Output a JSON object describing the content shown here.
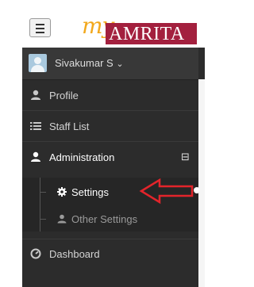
{
  "header": {
    "logo_prefix": "my",
    "logo_brand": "AMRITA"
  },
  "user": {
    "name": "Sivakumar S",
    "dropdown_glyph": "⌄"
  },
  "nav": {
    "profile": "Profile",
    "staff_list": "Staff List",
    "administration": "Administration",
    "collapse_glyph": "⊟",
    "settings": "Settings",
    "other_settings": "Other Settings",
    "dashboard": "Dashboard"
  },
  "colors": {
    "sidebar_bg": "#2c2c2c",
    "brand_red": "#a3203e",
    "brand_gold": "#f2a81d",
    "annotation_arrow": "#e3242b"
  }
}
